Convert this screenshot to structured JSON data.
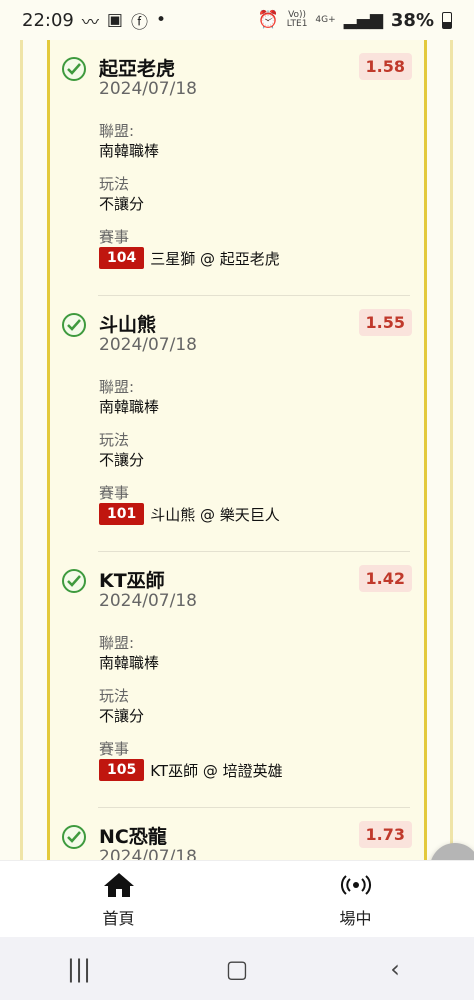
{
  "status": {
    "time": "22:09",
    "network_top": "Vo))",
    "network_bottom": "LTE1",
    "net_gen": "4G+",
    "battery": "38%"
  },
  "bets": [
    {
      "team": "起亞老虎",
      "date": "2024/07/18",
      "odds": "1.58",
      "league_label": "聯盟:",
      "league": "南韓職棒",
      "play_label": "玩法",
      "play": "不讓分",
      "event_label": "賽事",
      "game_no": "104",
      "matchup": "三星獅 @ 起亞老虎"
    },
    {
      "team": "斗山熊",
      "date": "2024/07/18",
      "odds": "1.55",
      "league_label": "聯盟:",
      "league": "南韓職棒",
      "play_label": "玩法",
      "play": "不讓分",
      "event_label": "賽事",
      "game_no": "101",
      "matchup": "斗山熊 @ 樂天巨人"
    },
    {
      "team": "KT巫師",
      "date": "2024/07/18",
      "odds": "1.42",
      "league_label": "聯盟:",
      "league": "南韓職棒",
      "play_label": "玩法",
      "play": "不讓分",
      "event_label": "賽事",
      "game_no": "105",
      "matchup": "KT巫師 @ 培證英雄"
    },
    {
      "team": "NC恐龍",
      "date": "2024/07/18",
      "odds": "1.73"
    }
  ],
  "nav": {
    "home_label": "首頁",
    "live_label": "場中"
  },
  "icons": {
    "check": "check-circle-icon",
    "home": "home-icon",
    "live": "broadcast-icon",
    "edit": "pencil-icon"
  },
  "colors": {
    "accent_red": "#c0160f",
    "odds_text": "#c0392b",
    "rail_yellow": "#e3c93c",
    "check_green": "#3e9a3e"
  }
}
